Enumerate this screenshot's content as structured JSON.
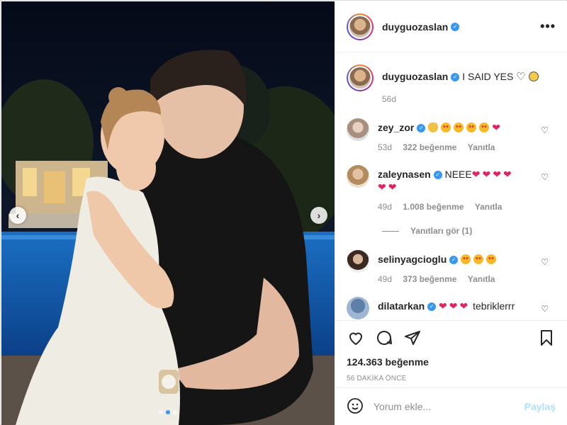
{
  "post": {
    "username": "duyguozaslan",
    "caption_text": "I SAID YES",
    "caption_age": "56d",
    "likes": "124.363 beğenme",
    "timestamp": "56 DAKİKA ÖNCE"
  },
  "header": {
    "more_label": "•••"
  },
  "media": {
    "prev_label": "‹",
    "next_label": "›",
    "slide_count": 3,
    "active_slide": 2
  },
  "comments": [
    {
      "username": "zey_zor",
      "text": "",
      "emojis": [
        "hand",
        "face",
        "face",
        "face",
        "face",
        "heart"
      ],
      "age": "53d",
      "likes": "322 beğenme",
      "reply": "Yanıtla"
    },
    {
      "username": "zaleynasen",
      "text": "NEEE",
      "emojis": [
        "heart",
        "heart",
        "heart",
        "heart",
        "heart",
        "heart"
      ],
      "age": "49d",
      "likes": "1.008 beğenme",
      "reply": "Yanıtla",
      "view_replies": "Yanıtları gör (1)"
    },
    {
      "username": "selinyagcioglu",
      "text": "",
      "emojis": [
        "face",
        "face",
        "face"
      ],
      "age": "49d",
      "likes": "373 beğenme",
      "reply": "Yanıtla"
    },
    {
      "username": "dilatarkan",
      "text": "tebriklerrr",
      "emojis": [
        "heart",
        "heart",
        "heart"
      ],
      "age": "",
      "likes": "",
      "reply": ""
    }
  ],
  "add_comment": {
    "placeholder": "Yorum ekle...",
    "post_label": "Paylaş"
  },
  "icons": {
    "like": "heart-icon",
    "comment": "comment-icon",
    "share": "share-icon",
    "save": "bookmark-icon",
    "emoji": "emoji-icon"
  },
  "colors": {
    "verified": "#3897f0",
    "heart": "#e0245e",
    "post_disabled": "#b2dffc",
    "muted": "#8e8e8e"
  }
}
